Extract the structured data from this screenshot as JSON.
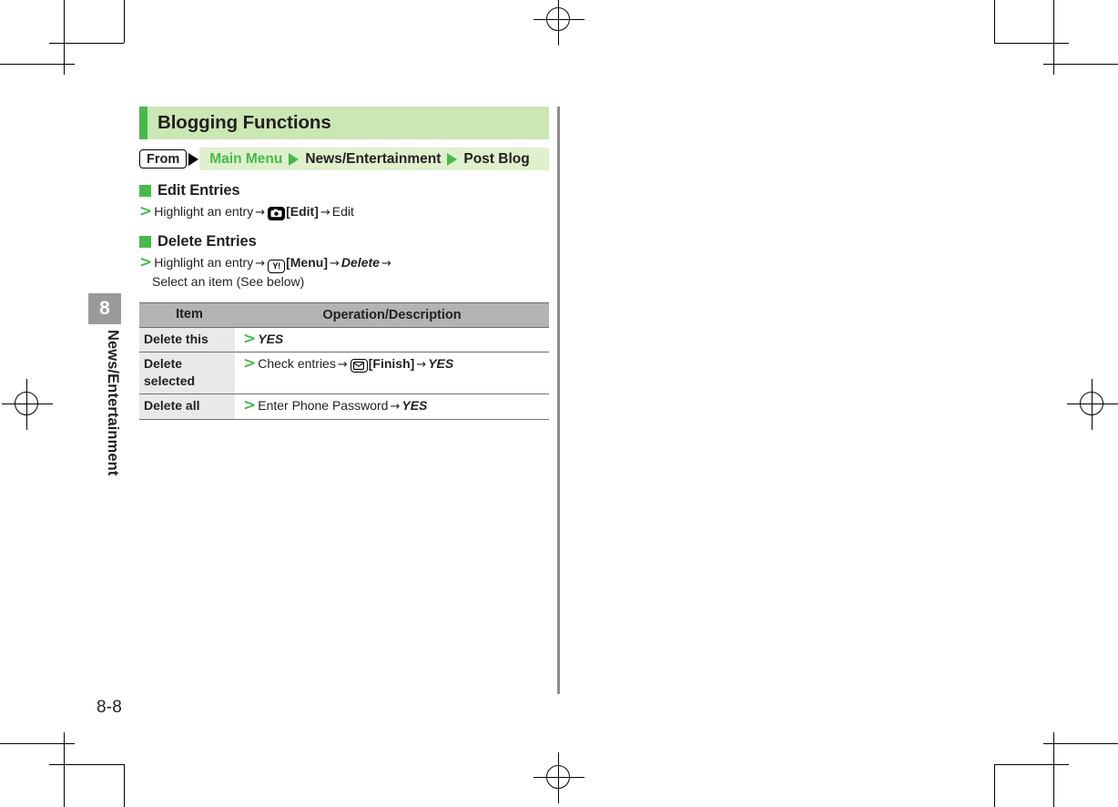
{
  "page": {
    "number": "8-8",
    "chapter_number": "8",
    "chapter_label": "News/Entertainment"
  },
  "section": {
    "title": "Blogging Functions"
  },
  "breadcrumb": {
    "from_label": "From",
    "crumbs": [
      {
        "text": "Main Menu",
        "color": "#46b94a"
      },
      {
        "text": "News/Entertainment",
        "color": "#231f20"
      },
      {
        "text": "Post Blog",
        "color": "#231f20"
      }
    ]
  },
  "subsections": [
    {
      "heading": "Edit Entries",
      "steps": [
        {
          "text_1": "Highlight an entry",
          "arrow_1": "→",
          "key": "camera-key-icon",
          "key_label": "[Edit]",
          "arrow_2": "→",
          "text_2": "Edit"
        }
      ]
    },
    {
      "heading": "Delete Entries",
      "steps": [
        {
          "text_1": "Highlight an entry",
          "arrow_1": "→",
          "key": "yahoo-key-icon",
          "key_label": "[Menu]",
          "arrow_2": "→",
          "italic": "Delete",
          "arrow_3": "→"
        }
      ],
      "continuation": "Select an item (See below)"
    }
  ],
  "table": {
    "headers": [
      "Item",
      "Operation/Description"
    ],
    "rows": [
      {
        "item": "Delete this",
        "op_parts": [
          {
            "type": "italic-bold",
            "text": "YES"
          }
        ]
      },
      {
        "item": "Delete selected",
        "op_parts": [
          {
            "type": "plain",
            "text": "Check entries"
          },
          {
            "type": "arrow",
            "text": "→"
          },
          {
            "type": "key",
            "icon": "mail-key-icon"
          },
          {
            "type": "bold",
            "text": "[Finish]"
          },
          {
            "type": "arrow",
            "text": "→"
          },
          {
            "type": "italic-bold",
            "text": "YES"
          }
        ]
      },
      {
        "item": "Delete all",
        "op_parts": [
          {
            "type": "plain",
            "text": "Enter Phone Password"
          },
          {
            "type": "arrow",
            "text": "→"
          },
          {
            "type": "italic-bold",
            "text": "YES"
          }
        ]
      }
    ]
  },
  "icons": {
    "camera": "camera-key-icon",
    "yahoo": "yahoo-key-icon",
    "mail": "mail-key-icon",
    "yahoo_glyph": "Y!",
    "bullet": ">"
  },
  "colors": {
    "accent_green": "#46b94a",
    "banner_green": "#cbe7b4",
    "band_green": "#dff0cc",
    "table_header_gray": "#b3b3b3",
    "table_item_gray": "#e9e9e9",
    "tab_gray": "#9a9a9a",
    "rule_gray": "#8d8d8f",
    "text": "#231f20"
  }
}
